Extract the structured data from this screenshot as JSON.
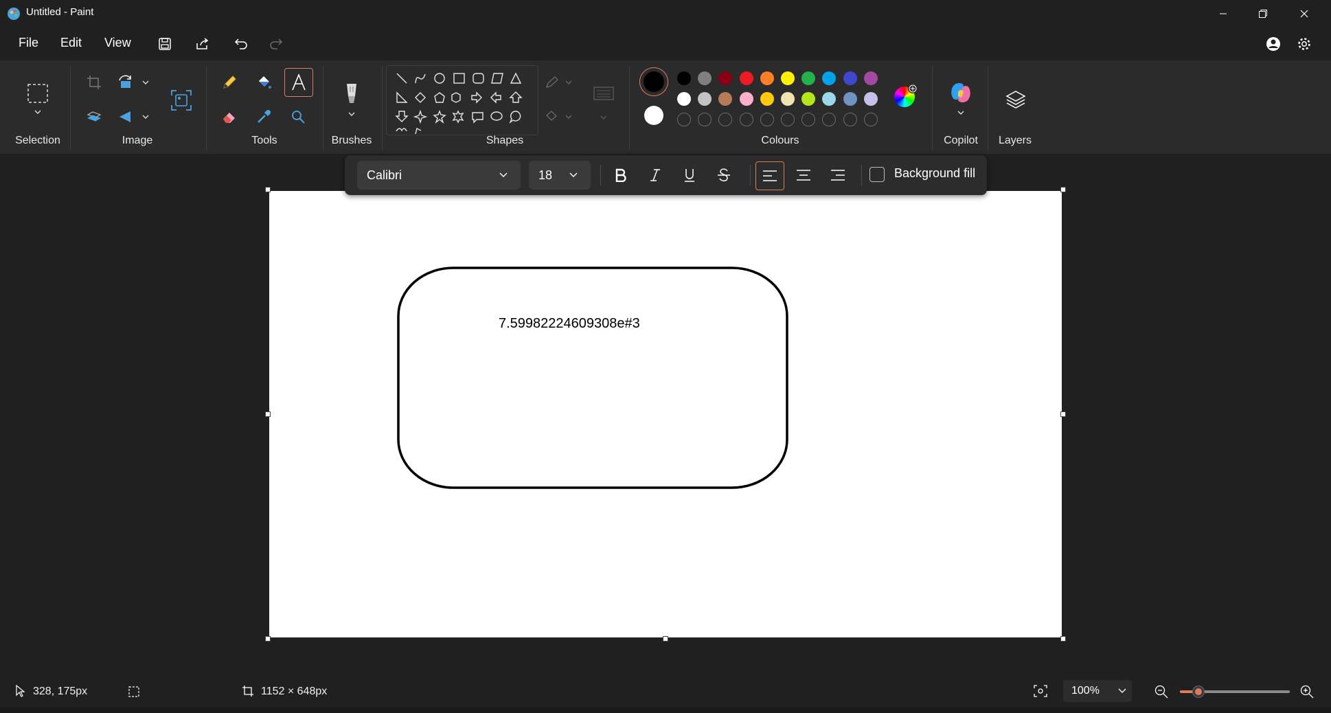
{
  "window": {
    "title": "Untitled - Paint"
  },
  "menu": {
    "file": "File",
    "edit": "Edit",
    "view": "View"
  },
  "ribbon": {
    "groups": {
      "selection": "Selection",
      "image": "Image",
      "tools": "Tools",
      "brushes": "Brushes",
      "shapes": "Shapes",
      "colours": "Colours",
      "copilot": "Copilot",
      "layers": "Layers"
    },
    "active_tool": "text-tool",
    "primary_color": "#000000",
    "secondary_color": "#ffffff",
    "palette_row1": [
      "#000000",
      "#7f7f7f",
      "#880015",
      "#ed1c24",
      "#ff7f27",
      "#fff200",
      "#22b14c",
      "#00a2e8",
      "#3f48cc",
      "#a349a4"
    ],
    "palette_row2": [
      "#ffffff",
      "#c3c3c3",
      "#b97a57",
      "#ffaec9",
      "#ffc90e",
      "#efe4b0",
      "#b5e61d",
      "#99d9ea",
      "#7092be",
      "#c8bfe7"
    ],
    "palette_row3_empty_count": 10
  },
  "text_toolbar": {
    "font": "Calibri",
    "size": "18",
    "background_fill_label": "Background fill",
    "background_fill_checked": false,
    "alignment": "left"
  },
  "canvas": {
    "text": "7.59982224609308e#3"
  },
  "status": {
    "cursor_position": "328, 175px",
    "canvas_size": "1152 × 648px",
    "zoom": "100%",
    "zoom_fraction": 0.17
  }
}
